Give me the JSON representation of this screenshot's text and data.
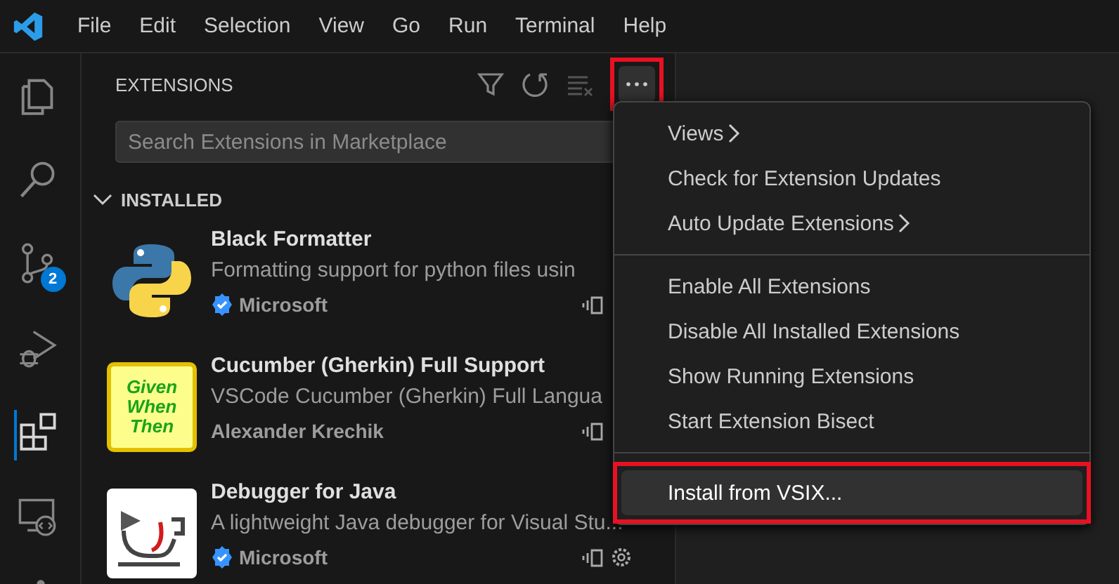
{
  "menubar": [
    "File",
    "Edit",
    "Selection",
    "View",
    "Go",
    "Run",
    "Terminal",
    "Help"
  ],
  "activity_bar": [
    {
      "kind": "explorer",
      "selected": false
    },
    {
      "kind": "search",
      "selected": false
    },
    {
      "kind": "source-control",
      "selected": false,
      "badge": "2"
    },
    {
      "kind": "run-debug",
      "selected": false
    },
    {
      "kind": "extensions",
      "selected": true
    },
    {
      "kind": "remote",
      "selected": false
    }
  ],
  "sidebar": {
    "title": "EXTENSIONS",
    "more_button_highlighted": true,
    "search": {
      "placeholder": "Search Extensions in Marketplace"
    },
    "section": {
      "title": "INSTALLED",
      "expanded": true
    },
    "extensions": [
      {
        "kind": "python",
        "name": "Black Formatter",
        "description": "Formatting support for python files usin",
        "publisher": "Microsoft",
        "verified": true,
        "gear": false
      },
      {
        "kind": "gherkin",
        "name": "Cucumber (Gherkin) Full Support",
        "description": "VSCode Cucumber (Gherkin) Full Langua",
        "publisher": "Alexander Krechik",
        "verified": false,
        "gear": false,
        "logo_text": [
          "Given",
          "When",
          "Then"
        ]
      },
      {
        "kind": "java-debug",
        "name": "Debugger for Java",
        "description": "A lightweight Java debugger for Visual Stu...",
        "publisher": "Microsoft",
        "verified": true,
        "gear": true
      }
    ]
  },
  "context_menu": {
    "groups": [
      [
        {
          "label": "Views",
          "submenu": true,
          "highlighted": false
        },
        {
          "label": "Check for Extension Updates",
          "submenu": false,
          "highlighted": false
        },
        {
          "label": "Auto Update Extensions",
          "submenu": true,
          "highlighted": false
        }
      ],
      [
        {
          "label": "Enable All Extensions",
          "submenu": false,
          "highlighted": false
        },
        {
          "label": "Disable All Installed Extensions",
          "submenu": false,
          "highlighted": false
        },
        {
          "label": "Show Running Extensions",
          "submenu": false,
          "highlighted": false
        },
        {
          "label": "Start Extension Bisect",
          "submenu": false,
          "highlighted": false
        }
      ],
      [
        {
          "label": "Install from VSIX...",
          "submenu": false,
          "highlighted": true
        }
      ]
    ]
  }
}
